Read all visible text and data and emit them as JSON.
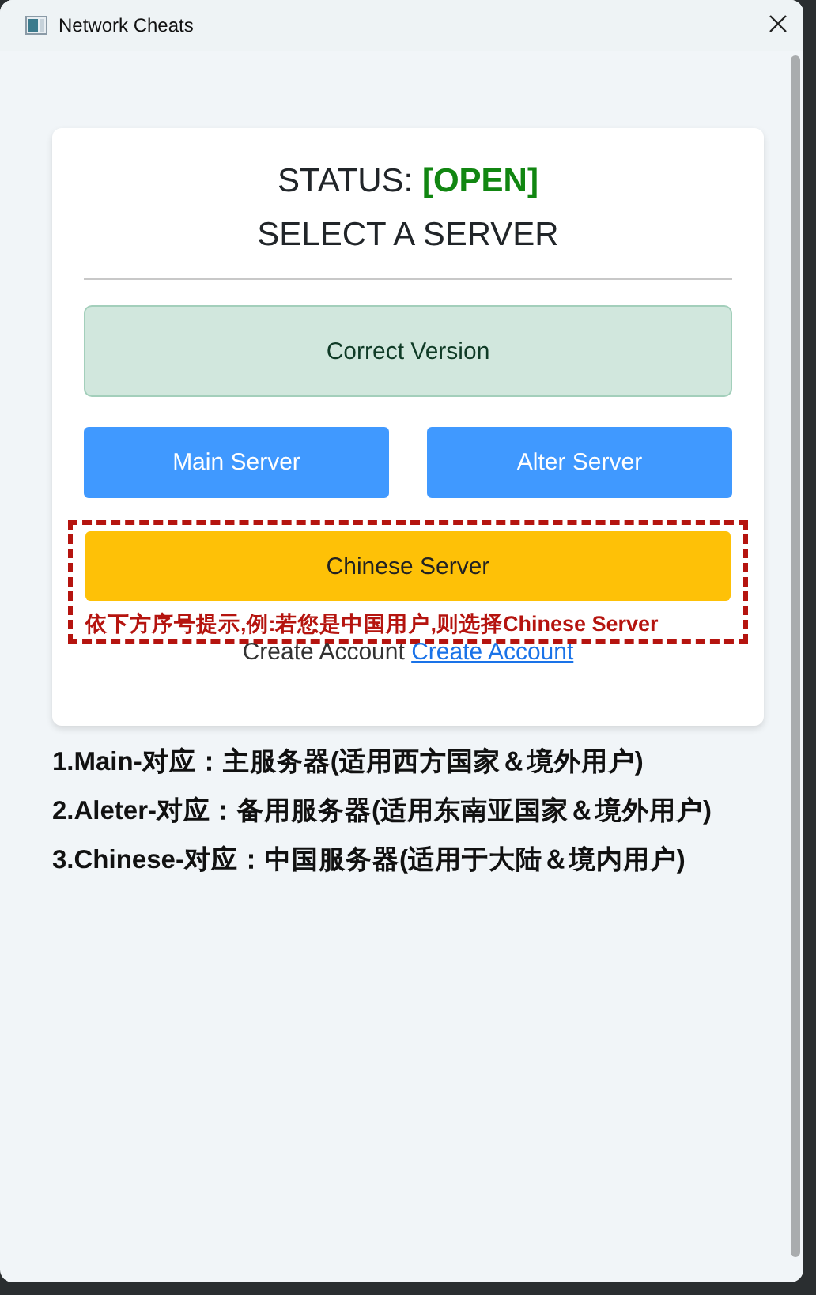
{
  "window": {
    "title": "Network Cheats"
  },
  "card": {
    "status_label": "STATUS:",
    "status_value": "[OPEN]",
    "heading": "SELECT A SERVER",
    "buttons": [
      {
        "kind": "success",
        "label": "Correct Version"
      },
      {
        "kind": "primary",
        "label": "Main Server"
      },
      {
        "kind": "primary",
        "label": "Alter Server"
      },
      {
        "kind": "warning",
        "label": "Chinese Server"
      }
    ],
    "hint": "依下方序号提示,例:若您是中国用户,则选择Chinese Server",
    "account_text": "Create Account",
    "account_link": "Create Account"
  },
  "notes": [
    "1.Main-对应：主服务器(适用西方国家＆境外用户)",
    "2.Aleter-对应：备用服务器(适用东南亚国家＆境外用户)",
    "3.Chinese-对应：中国服务器(适用于大陆＆境内用户)"
  ]
}
